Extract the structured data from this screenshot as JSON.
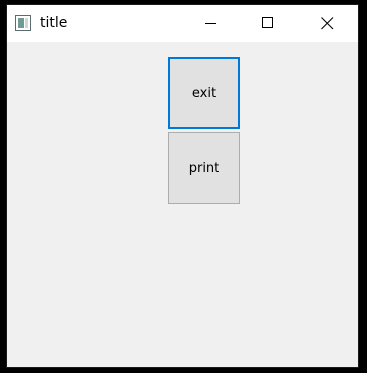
{
  "window": {
    "title": "title"
  },
  "buttons": {
    "exit_label": "exit",
    "print_label": "print"
  },
  "colors": {
    "focus_border": "#0078d7",
    "button_face": "#e1e1e1",
    "client_background": "#f0f0f0"
  },
  "icons": {
    "app": "app-window-icon",
    "minimize": "minimize-icon",
    "maximize": "maximize-icon",
    "close": "close-icon"
  }
}
